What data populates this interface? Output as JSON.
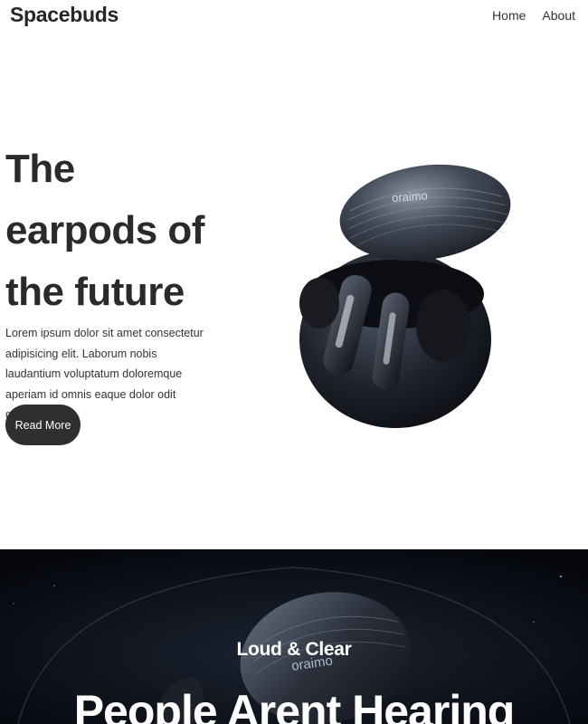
{
  "header": {
    "logo": "Spacebuds",
    "nav": [
      {
        "label": "Home"
      },
      {
        "label": "About"
      }
    ]
  },
  "hero": {
    "title_lines": [
      "The",
      "earpods of",
      "the future"
    ],
    "description": "Lorem ipsum dolor sit amet consectetur adipisicing elit. Laborum nobis laudantium voluptatum doloremque aperiam id omnis eaque dolor odit quam!",
    "button_label": "Read More",
    "product_brand": "oraimo"
  },
  "feature": {
    "subtitle": "Loud & Clear",
    "title": "People Arent Hearing",
    "product_brand": "oraimo"
  },
  "colors": {
    "text": "#2a2a2a",
    "button": "#2f2f2f",
    "dark_bg": "#05070c"
  }
}
